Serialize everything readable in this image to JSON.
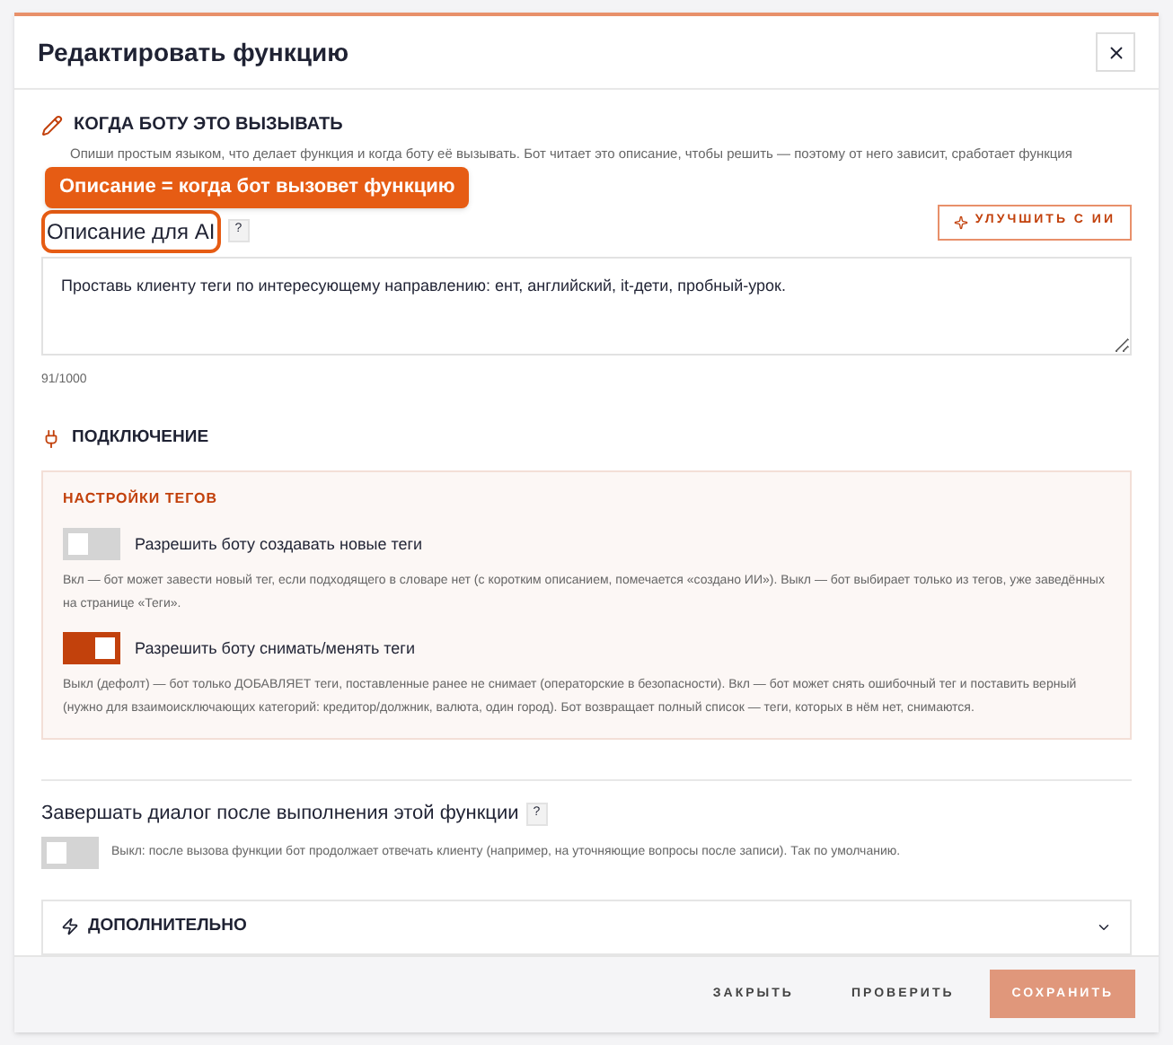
{
  "window": {
    "title": "Редактировать функцию"
  },
  "when_to_call": {
    "title": "КОГДА БОТУ ЭТО ВЫЗЫВАТЬ",
    "description": "Опиши простым языком, что делает функция и когда боту её вызывать. Бот читает это описание, чтобы решить — поэтому от него зависит, сработает функция",
    "tooltip": "Описание = когда бот вызовет функцию",
    "field_label": "Описание для AI",
    "help": "?",
    "improve_button": "УЛУЧШИТЬ С ИИ",
    "value": "Проставь клиенту теги по интересующему направлению: ент, английский, it-дети, пробный-урок.",
    "counter": "91/1000"
  },
  "connection": {
    "title": "ПОДКЛЮЧЕНИЕ",
    "panel_title": "НАСТРОЙКИ ТЕГОВ",
    "toggles": [
      {
        "label": "Разрешить боту создавать новые теги",
        "on": false,
        "hint": "Вкл — бот может завести новый тег, если подходящего в словаре нет (с коротким описанием, помечается «создано ИИ»). Выкл — бот выбирает только из тегов, уже заведённых на странице «Теги»."
      },
      {
        "label": "Разрешить боту снимать/менять теги",
        "on": true,
        "hint": "Выкл (дефолт) — бот только ДОБАВЛЯЕТ теги, поставленные ранее не снимает (операторские в безопасности). Вкл — бот может снять ошибочный тег и поставить верный (нужно для взаимоисключающих категорий: кредитор/должник, валюта, один город). Бот возвращает полный список — теги, которых в нём нет, снимаются."
      }
    ]
  },
  "finish_dialog": {
    "label": "Завершать диалог после выполнения этой функции",
    "help": "?",
    "on": false,
    "hint": "Выкл: после вызова функции бот продолжает отвечать клиенту (например, на уточняющие вопросы после записи). Так по умолчанию."
  },
  "advanced": {
    "title": "ДОПОЛНИТЕЛЬНО",
    "expanded": false
  },
  "footer": {
    "buttons": [
      {
        "label": "ЗАКРЫТЬ",
        "kind": "text"
      },
      {
        "label": "ПРОВЕРИТЬ",
        "kind": "text"
      },
      {
        "label": "СОХРАНИТЬ",
        "kind": "primary"
      }
    ]
  }
}
